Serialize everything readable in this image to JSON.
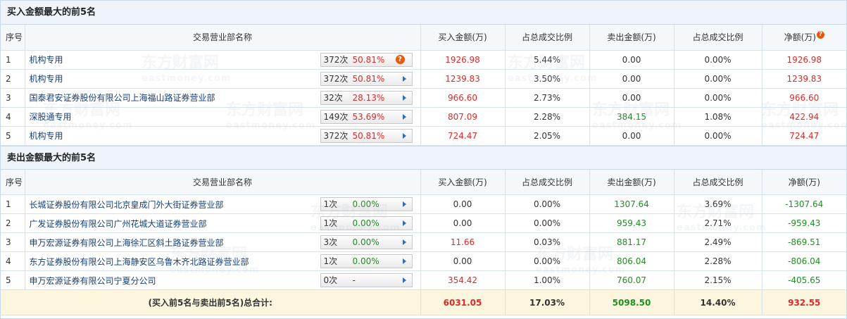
{
  "buy_section": {
    "title": "买入金额最大的前5名",
    "headers": [
      "序号",
      "交易营业部名称",
      "买入金额(万)",
      "占总成交比例",
      "卖出金额(万)",
      "占总成交比例",
      "净额(万)"
    ],
    "rows": [
      {
        "idx": "1",
        "name": "机构专用",
        "count": "372次",
        "pct": "50.81%",
        "buy": "1926.98",
        "buy_ratio": "5.44%",
        "sell": "0.00",
        "sell_ratio": "0.00%",
        "net": "1926.98"
      },
      {
        "idx": "2",
        "name": "机构专用",
        "count": "372次",
        "pct": "50.81%",
        "buy": "1239.83",
        "buy_ratio": "3.50%",
        "sell": "0.00",
        "sell_ratio": "0.00%",
        "net": "1239.83"
      },
      {
        "idx": "3",
        "name": "国泰君安证券股份有限公司上海福山路证券营业部",
        "count": "32次",
        "pct": "28.13%",
        "buy": "966.60",
        "buy_ratio": "2.73%",
        "sell": "0.00",
        "sell_ratio": "0.00%",
        "net": "966.60"
      },
      {
        "idx": "4",
        "name": "深股通专用",
        "count": "149次",
        "pct": "53.69%",
        "buy": "807.09",
        "buy_ratio": "2.28%",
        "sell": "384.15",
        "sell_ratio": "1.08%",
        "net": "422.94"
      },
      {
        "idx": "5",
        "name": "机构专用",
        "count": "372次",
        "pct": "50.81%",
        "buy": "724.47",
        "buy_ratio": "2.05%",
        "sell": "0.00",
        "sell_ratio": "0.00%",
        "net": "724.47"
      }
    ]
  },
  "sell_section": {
    "title": "卖出金额最大的前5名",
    "headers": [
      "序号",
      "交易营业部名称",
      "买入金额(万)",
      "占总成交比例",
      "卖出金额(万)",
      "占总成交比例",
      "净额(万)"
    ],
    "rows": [
      {
        "idx": "1",
        "name": "长城证券股份有限公司北京皇成门外大街证券营业部",
        "count": "1次",
        "pct": "0.00%",
        "buy": "0.00",
        "buy_ratio": "0.00%",
        "sell": "1307.64",
        "sell_ratio": "3.69%",
        "net": "-1307.64"
      },
      {
        "idx": "2",
        "name": "广发证券股份有限公司广州花城大道证券营业部",
        "count": "1次",
        "pct": "0.00%",
        "buy": "0.00",
        "buy_ratio": "0.00%",
        "sell": "959.43",
        "sell_ratio": "2.71%",
        "net": "-959.43"
      },
      {
        "idx": "3",
        "name": "申万宏源证券有限公司上海徐汇区斜土路证券营业部",
        "count": "3次",
        "pct": "0.00%",
        "buy": "11.66",
        "buy_ratio": "0.03%",
        "sell": "881.17",
        "sell_ratio": "2.49%",
        "net": "-869.51"
      },
      {
        "idx": "4",
        "name": "东方证券股份有限公司上海静安区乌鲁木齐北路证券营业部",
        "count": "1次",
        "pct": "0.00%",
        "buy": "0.00",
        "buy_ratio": "0.00%",
        "sell": "806.04",
        "sell_ratio": "2.28%",
        "net": "-806.04"
      },
      {
        "idx": "5",
        "name": "申万宏源证券有限公司宁夏分公司",
        "count": "0次",
        "pct": "-",
        "buy": "354.42",
        "buy_ratio": "1.00%",
        "sell": "760.07",
        "sell_ratio": "2.15%",
        "net": "-405.65"
      }
    ]
  },
  "summary": {
    "label": "(买入前5名与卖出前5名)总合计:",
    "buy": "6031.05",
    "buy_ratio": "17.03%",
    "sell": "5098.50",
    "sell_ratio": "14.40%",
    "net": "932.55"
  },
  "watermark": {
    "cn": "东方财富网",
    "en": "eastmoney.com"
  },
  "icons": {
    "help": "question-circle-icon",
    "arrow": "play-right-icon"
  },
  "colors": {
    "positive": "#e02828",
    "negative": "#1f8f1f",
    "header_bg": "#eef4fa",
    "footer_bg": "#fbf6dd",
    "link": "#15407a"
  }
}
